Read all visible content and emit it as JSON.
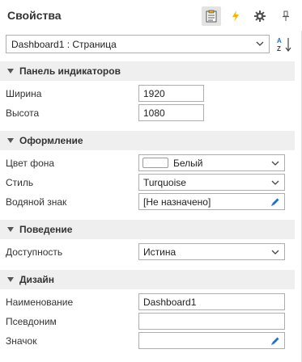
{
  "title": "Свойства",
  "toolbar": {
    "properties_icon": "properties-sheet-icon",
    "events_icon": "lightning-icon",
    "settings_icon": "gear-icon",
    "pin_icon": "pin-icon",
    "accent_color": "#f2b600"
  },
  "object_selector": {
    "value": "Dashboard1 : Страница"
  },
  "sections": {
    "indicators": {
      "title": "Панель индикаторов",
      "width_label": "Ширина",
      "width_value": "1920",
      "height_label": "Высота",
      "height_value": "1080"
    },
    "appearance": {
      "title": "Оформление",
      "bg_label": "Цвет фона",
      "bg_value": "Белый",
      "bg_color": "#ffffff",
      "style_label": "Стиль",
      "style_value": "Turquoise",
      "watermark_label": "Водяной знак",
      "watermark_value": "[Не назначено]"
    },
    "behavior": {
      "title": "Поведение",
      "availability_label": "Доступность",
      "availability_value": "Истина"
    },
    "design": {
      "title": "Дизайн",
      "name_label": "Наименование",
      "name_value": "Dashboard1",
      "alias_label": "Псевдоним",
      "alias_value": "",
      "icon_label": "Значок",
      "icon_value": ""
    }
  },
  "colors": {
    "pencil": "#1f6fd1",
    "section_bg": "#efefef"
  }
}
